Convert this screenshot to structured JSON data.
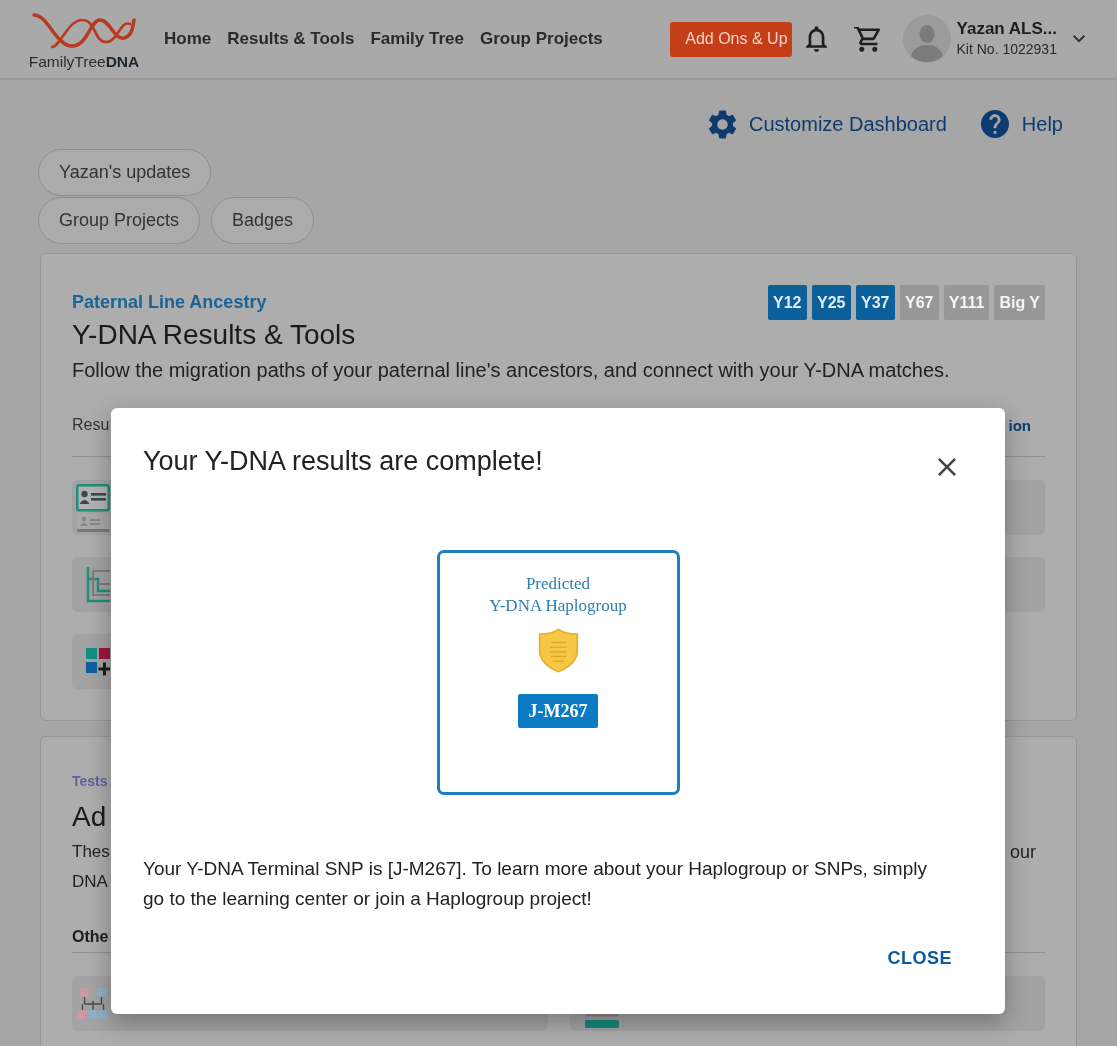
{
  "header": {
    "logo": "FamilyTree**DNA**",
    "nav": [
      {
        "label": "Home"
      },
      {
        "label": "Results & Tools"
      },
      {
        "label": "Family Tree"
      },
      {
        "label": "Group Projects"
      }
    ],
    "add_ons_button": "Add Ons & Up",
    "user": {
      "name": "Yazan ALS...",
      "kit": "Kit No. 1022931"
    }
  },
  "dashboard_links": [
    {
      "kind": "customize",
      "label": "Customize Dashboard"
    },
    {
      "kind": "help",
      "label": "Help"
    }
  ],
  "chips": [
    {
      "label": "Yazan's updates"
    },
    {
      "label": "Group Projects"
    },
    {
      "label": "Badges"
    }
  ],
  "paternal_card": {
    "eyebrow": "Paternal Line Ancestry",
    "tests": [
      {
        "label": "Y12",
        "completed": true
      },
      {
        "label": "Y25",
        "completed": true
      },
      {
        "label": "Y37",
        "completed": true
      },
      {
        "label": "Y67",
        "completed": false
      },
      {
        "label": "Y111",
        "completed": false
      },
      {
        "label": "Big Y",
        "completed": false
      }
    ],
    "title": "Y-DNA Results & Tools",
    "description": "Follow the migration paths of your paternal line's ancestors, and connect with your Y-DNA matches.",
    "section_heading": "Resu",
    "section_link": "ion",
    "rows": [
      {
        "kind": "profile"
      },
      {
        "kind": "tree"
      },
      {
        "kind": "squares"
      }
    ]
  },
  "tests_card": {
    "eyebrow": "Tests",
    "title": "Ad",
    "description_left": [
      "Thes",
      "DNA"
    ],
    "description_right": "our",
    "section_heading": "Othe",
    "rows": [
      {
        "kind": "chart"
      },
      {
        "kind": "list"
      }
    ]
  },
  "dialog": {
    "title": "Your Y-DNA results are complete!",
    "certificate": {
      "heading": [
        "Predicted",
        "Y-DNA Haplogroup"
      ],
      "haplogroup": "J-M267"
    },
    "message": "Your Y-DNA Terminal SNP is [J-M267]. To learn more about your Haplogroup or SNPs, simply go to the learning center or join a Haplogroup project!",
    "close_button": "CLOSE"
  }
}
